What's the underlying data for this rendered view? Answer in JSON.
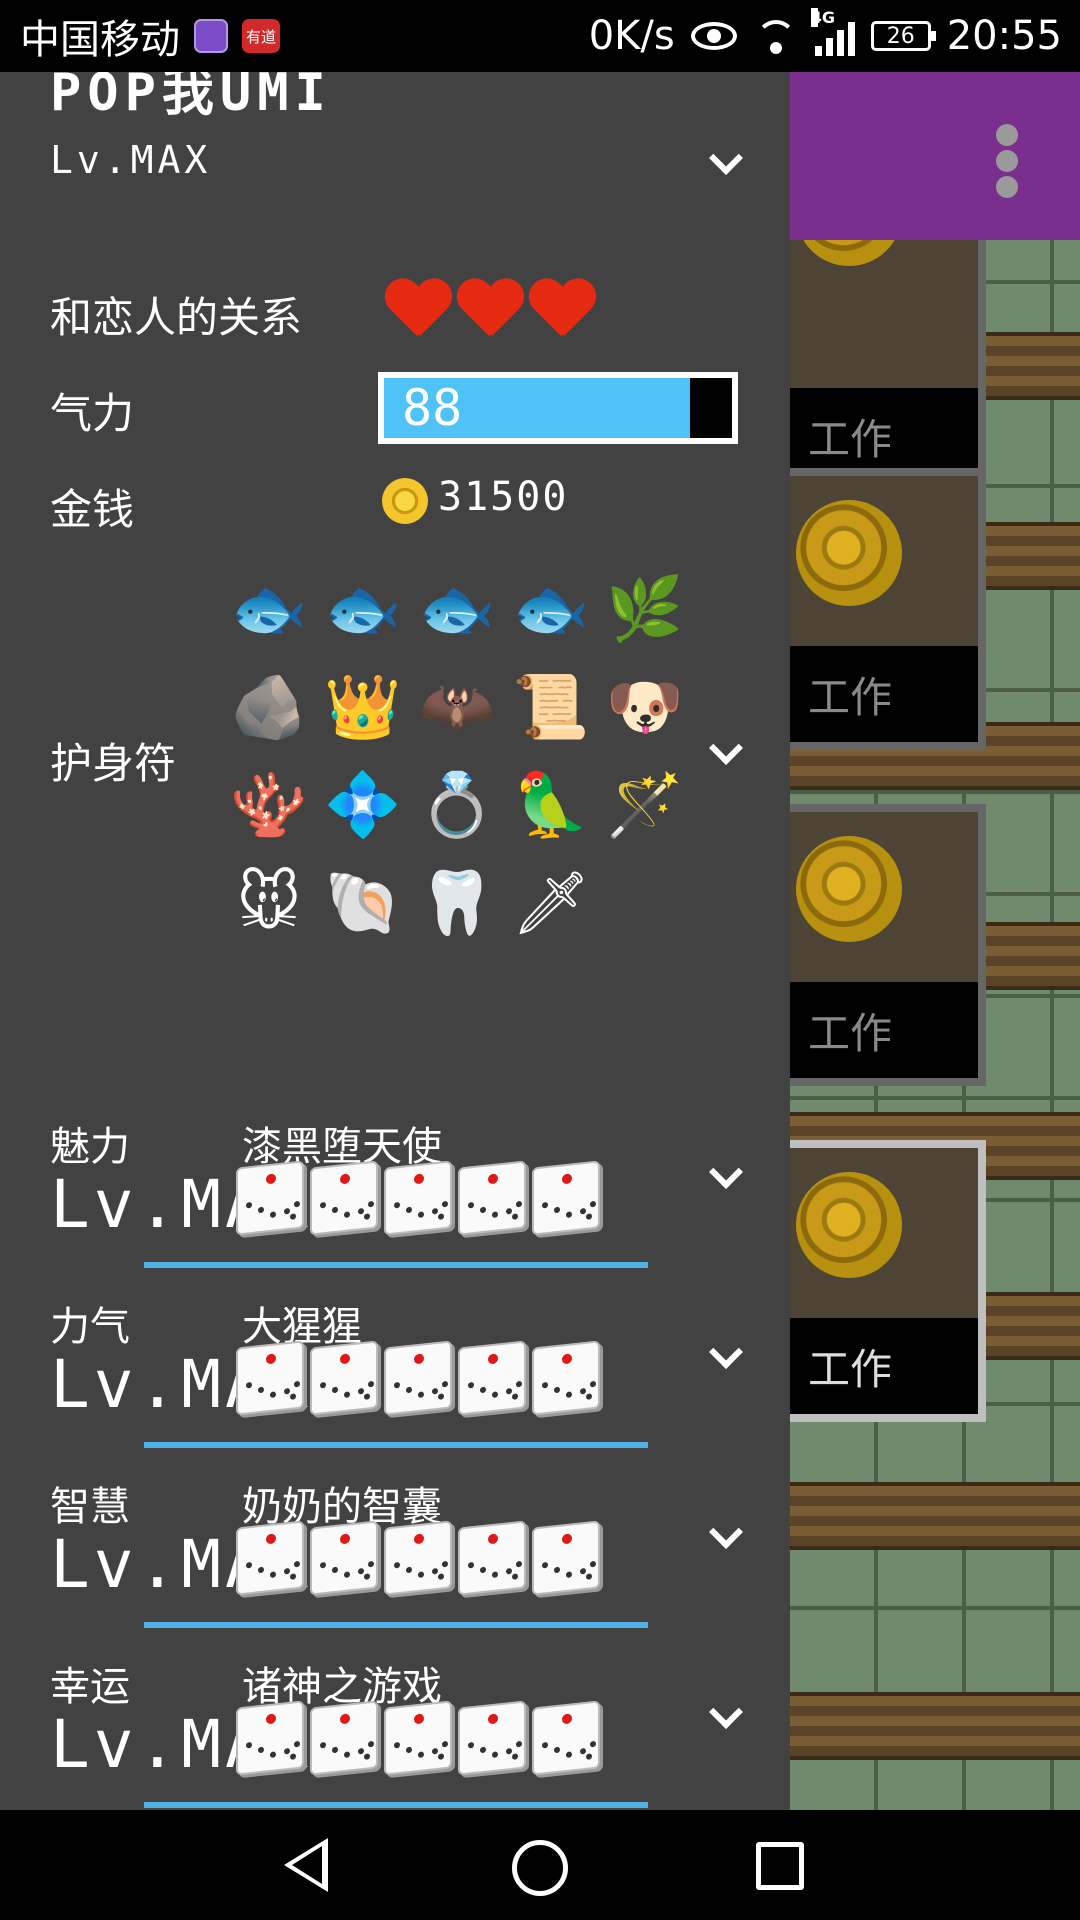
{
  "statusbar": {
    "carrier": "中国移动",
    "app2_label": "有道",
    "net_speed": "0K/s",
    "network": "4G",
    "battery": "26",
    "time": "20:55"
  },
  "player": {
    "name": "POP我UMI",
    "level": "Lv.MAX"
  },
  "relationship": {
    "label": "和恋人的关系",
    "hearts": 3
  },
  "energy": {
    "label": "气力",
    "value": "88",
    "fill_fraction": 0.88
  },
  "money": {
    "label": "金钱",
    "amount": "31500"
  },
  "charms": {
    "label": "护身符",
    "items": [
      {
        "icon": "🐟",
        "name": "fish-icon"
      },
      {
        "icon": "🐟",
        "name": "fish-icon"
      },
      {
        "icon": "🐟",
        "name": "fish-icon"
      },
      {
        "icon": "🐟",
        "name": "fish-icon"
      },
      {
        "icon": "🌿",
        "name": "branch-icon"
      },
      {
        "icon": "🪨",
        "name": "fossil-stone-icon"
      },
      {
        "icon": "👑",
        "name": "crown-icon"
      },
      {
        "icon": "🦇",
        "name": "bat-wings-icon"
      },
      {
        "icon": "📜",
        "name": "talisman-paper-icon"
      },
      {
        "icon": "🐶",
        "name": "puppy-icon"
      },
      {
        "icon": "🪸",
        "name": "coral-icon"
      },
      {
        "icon": "💠",
        "name": "tiara-icon"
      },
      {
        "icon": "💍",
        "name": "ring-icon"
      },
      {
        "icon": "🦜",
        "name": "red-bird-icon"
      },
      {
        "icon": "🪄",
        "name": "magic-wand-icon"
      },
      {
        "icon": "🐭",
        "name": "mouse-icon"
      },
      {
        "icon": "🐚",
        "name": "ammonite-shell-icon"
      },
      {
        "icon": "🦷",
        "name": "horn-icon"
      },
      {
        "icon": "🗡",
        "name": "sword-icon"
      }
    ]
  },
  "stats": [
    {
      "name": "魅力",
      "title": "漆黑堕天使",
      "level": "Lv.MAX"
    },
    {
      "name": "力气",
      "title": "大猩猩",
      "level": "Lv.MAX"
    },
    {
      "name": "智慧",
      "title": "奶奶的智囊",
      "level": "Lv.MAX"
    },
    {
      "name": "幸运",
      "title": "诸神之游戏",
      "level": "Lv.MAX"
    }
  ],
  "work_cards": [
    {
      "label": "工作"
    },
    {
      "label": "工作"
    },
    {
      "label": "工作"
    },
    {
      "label": "工作"
    }
  ],
  "colors": {
    "drawer_bg": "#424242",
    "accent_blue": "#4fc3f7",
    "header_purple": "#7a2f8e",
    "heart_red": "#e62a12"
  }
}
